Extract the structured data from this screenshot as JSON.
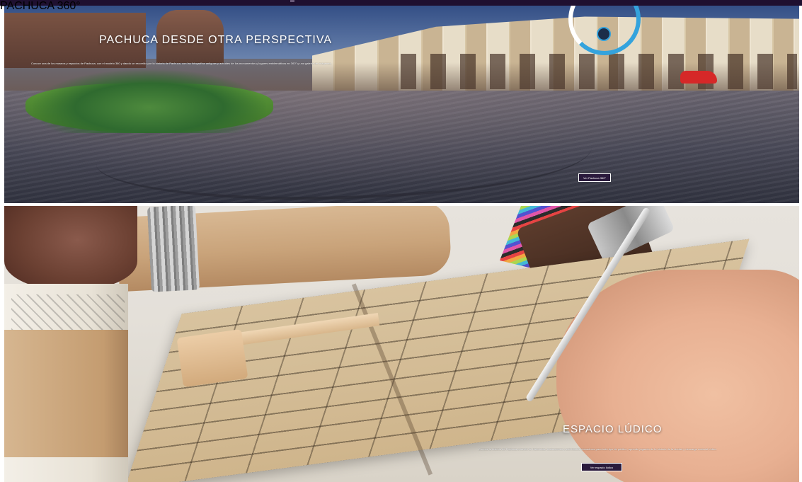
{
  "hero_360": {
    "title": "PACHUCA DESDE OTRA PERSPECTIVA",
    "description": "Conoce una de los museos y espacios de Pachuca, con el modelo 360 y dando un recorrido por la historia de Pachuca, con las fotografías antiguas y actuales de los monumentos y lugares emblemáticos en 360° y una galería de imágenes.",
    "logo_text": "PACHUCA 360°",
    "button_label": "Ver Pachuca 360°"
  },
  "hero_ludico": {
    "title": "ESPACIO LÚDICO",
    "description": "Conoce la historia de Pachuca a través de historietas, ilustraciones y actividades interactivas para todo tipo de público, aprende jugando de la historia de la ciudad y descarga material lúdico.",
    "button_label": "Ver espacio lúdico"
  },
  "colors": {
    "topbar": "#1f1030",
    "button_bg": "#2a1a3c",
    "logo_accent": "#34a3dd"
  }
}
